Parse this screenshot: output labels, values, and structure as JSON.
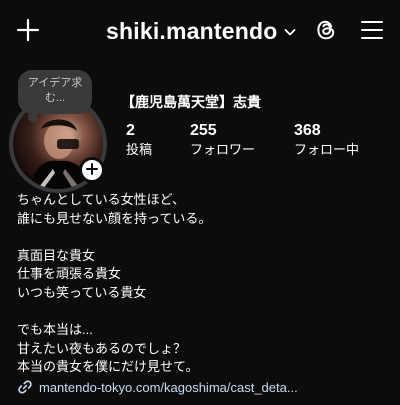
{
  "header": {
    "username": "shiki.mantendo",
    "icons": [
      "plus-icon",
      "chevron-down-icon",
      "threads-icon",
      "menu-icon"
    ]
  },
  "profile": {
    "note": "アイデア求む...",
    "display_name": "【鹿児島萬天堂】志貴",
    "stats": [
      {
        "value": "2",
        "label": "投稿"
      },
      {
        "value": "255",
        "label": "フォロワー"
      },
      {
        "value": "368",
        "label": "フォロー中"
      }
    ],
    "bio": [
      "ちゃんとしている女性ほど、",
      "誰にも見せない顔を持っている。",
      "",
      "真面目な貴女",
      "仕事を頑張る貴女",
      "いつも笑っている貴女",
      "",
      "でも本当は...",
      "甘えたい夜もあるのでしょ？",
      "本当の貴女を僕にだけ見せて。"
    ],
    "link": "mantendo-tokyo.com/kagoshima/cast_deta..."
  },
  "colors": {
    "background": "#0c0c0d",
    "text": "#ffffff",
    "link": "#c7dcf2",
    "bubble": "#3a3a3c"
  }
}
